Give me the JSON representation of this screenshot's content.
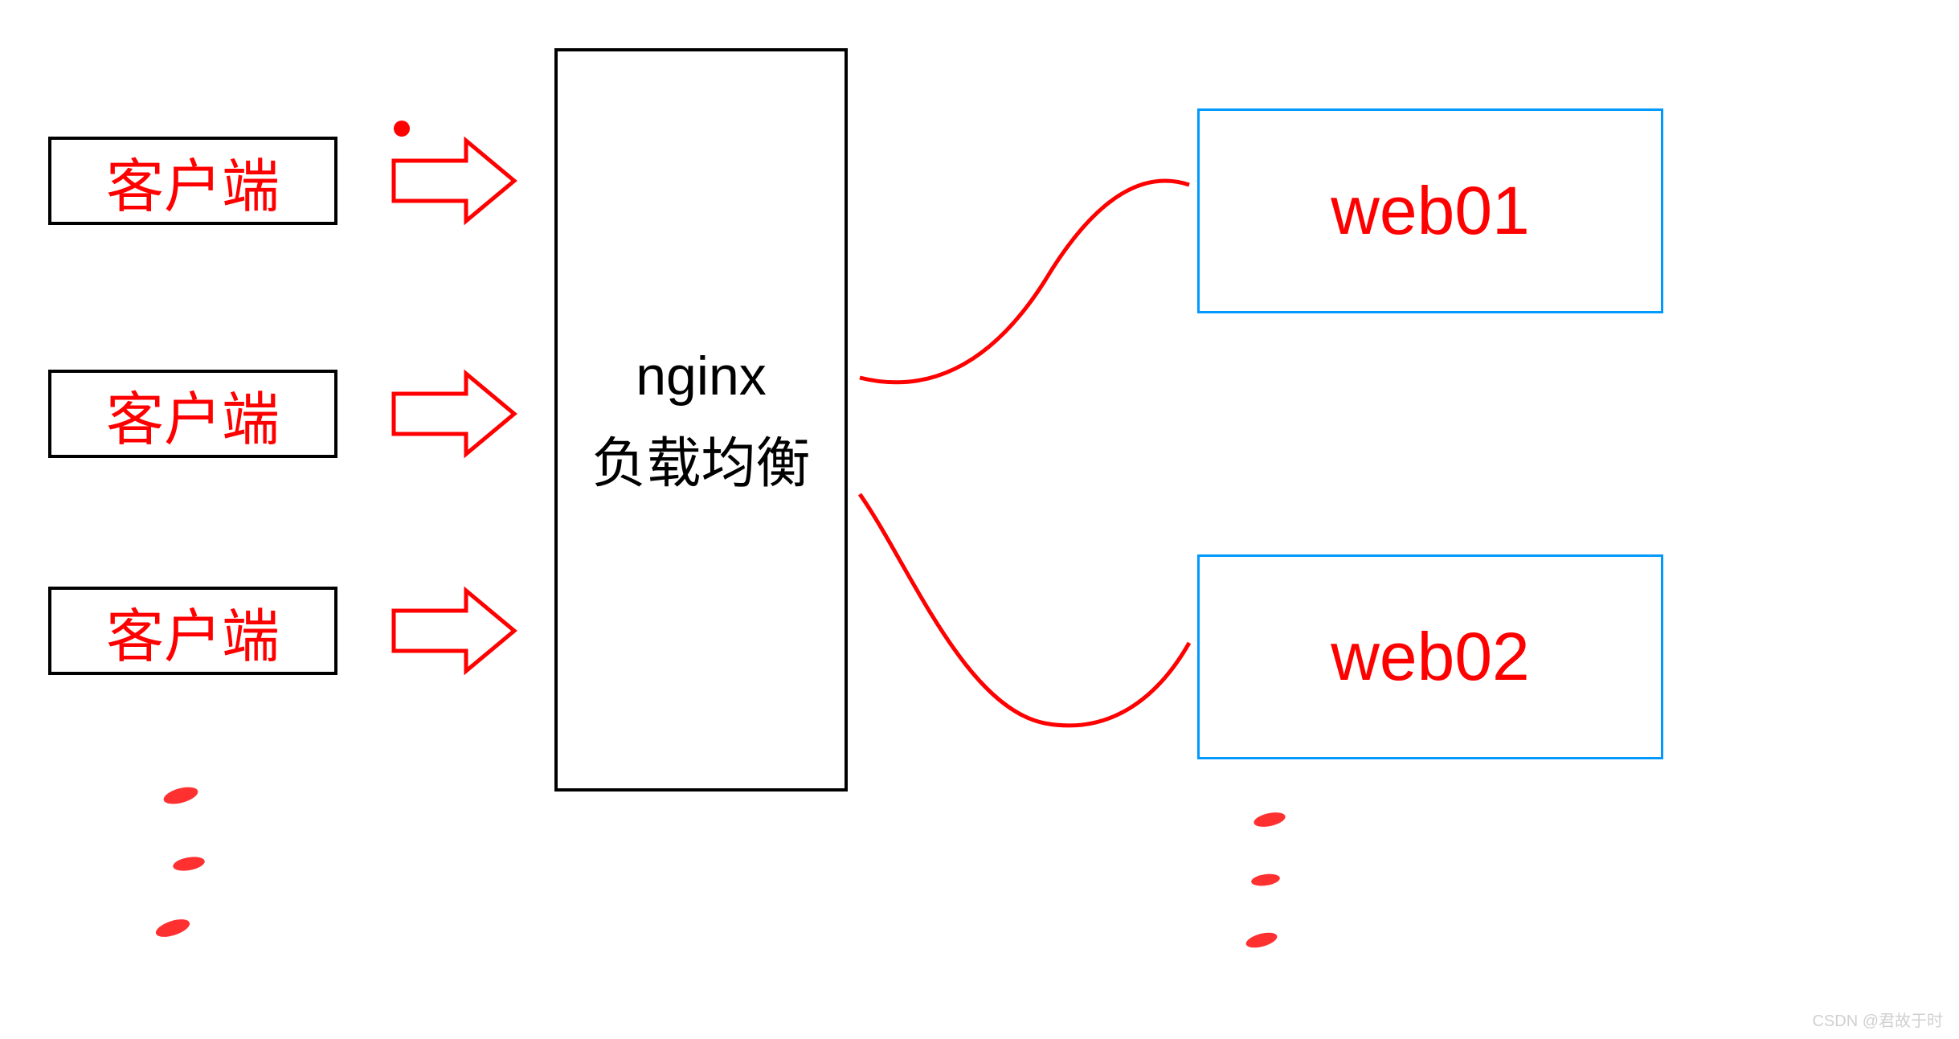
{
  "clients": [
    {
      "label": "客户端"
    },
    {
      "label": "客户端"
    },
    {
      "label": "客户端"
    }
  ],
  "loadbalancer": {
    "line1": "nginx",
    "line2": "负载均衡"
  },
  "servers": [
    {
      "label": "web01"
    },
    {
      "label": "web02"
    }
  ],
  "watermark": "CSDN @君故于时",
  "colors": {
    "red": "#ff0000",
    "blue": "#0099ff",
    "black": "#000000"
  }
}
